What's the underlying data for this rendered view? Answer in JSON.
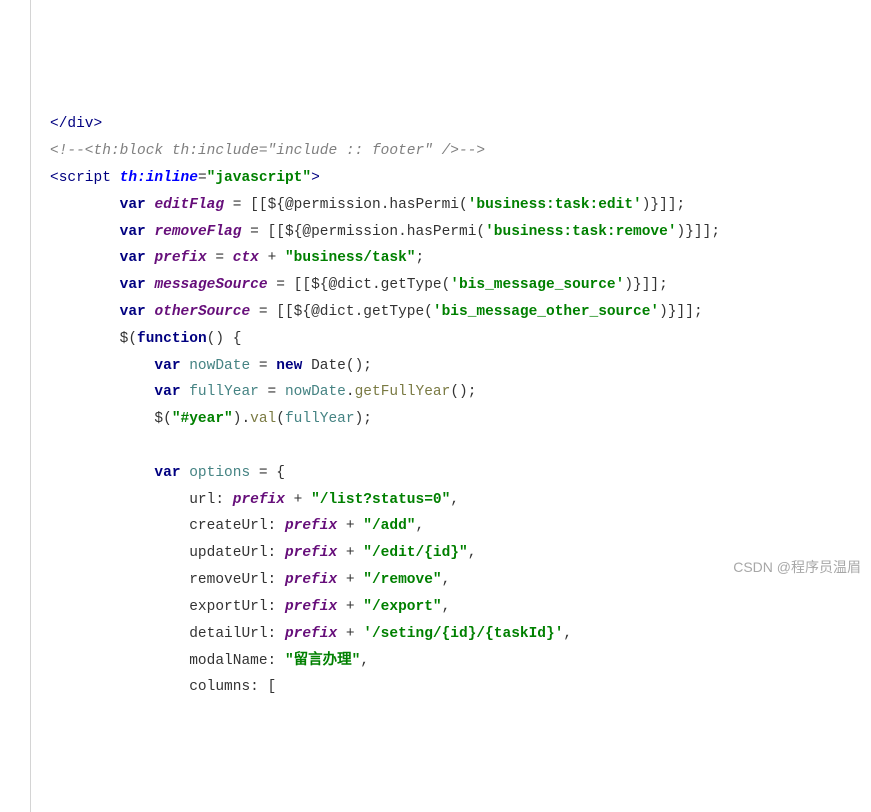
{
  "line1": {
    "closeDiv": "</",
    "div": "div",
    "gt": ">"
  },
  "line2": {
    "open": "<!--<th:block th:include=\"include :: footer\" />-->"
  },
  "line3": {
    "lt": "<",
    "script": "script",
    "sp": " ",
    "attr": "th:inline",
    "eq": "=",
    "q": "\"",
    "val": "javascript",
    "gt": ">"
  },
  "line4": {
    "indent": "        ",
    "kw": "var",
    "sp": " ",
    "ivar": "editFlag",
    "eq": " = [[${@permission.hasPermi(",
    "s": "'business:task:edit'",
    "tail": ")}]];"
  },
  "line5": {
    "indent": "        ",
    "kw": "var",
    "sp": " ",
    "ivar": "removeFlag",
    "eq": " = [[${@permission.hasPermi(",
    "s": "'business:task:remove'",
    "tail": ")}]];"
  },
  "line6": {
    "indent": "        ",
    "kw": "var",
    "sp": " ",
    "ivar": "prefix",
    "eq": " = ",
    "ctx": "ctx",
    "plus": " + ",
    "s": "\"business/task\"",
    "semi": ";"
  },
  "line7": {
    "indent": "        ",
    "kw": "var",
    "sp": " ",
    "ivar": "messageSource",
    "eq": " = [[${@dict.getType(",
    "s": "'bis_message_source'",
    "tail": ")}]];"
  },
  "line8": {
    "indent": "        ",
    "kw": "var",
    "sp": " ",
    "ivar": "otherSource",
    "eq": " = [[${@dict.getType(",
    "s": "'bis_message_other_source'",
    "tail": ")}]];"
  },
  "line9": {
    "indent": "        ",
    "txt1": "$(",
    "kw": "function",
    "txt2": "() {"
  },
  "line10": {
    "indent": "            ",
    "kw1": "var",
    "sp": " ",
    "lvar": "nowDate",
    "eq": " = ",
    "kw2": "new",
    "sp2": " ",
    "date": "Date",
    "tail": "();"
  },
  "line11": {
    "indent": "            ",
    "kw1": "var",
    "sp": " ",
    "lvar": "fullYear",
    "eq": " = ",
    "nowDate": "nowDate",
    "dot": ".",
    "fn": "getFullYear",
    "tail": "();"
  },
  "line12": {
    "indent": "            ",
    "a": "$(",
    "s": "\"#year\"",
    "b": ").",
    "fn": "val",
    "c": "(",
    "lvar": "fullYear",
    "d": ");"
  },
  "blank13": " ",
  "line14": {
    "indent": "            ",
    "kw": "var",
    "sp": " ",
    "lvar": "options",
    "tail": " = {"
  },
  "line15": {
    "indent": "                ",
    "key": "url: ",
    "ivar": "prefix",
    "plus": " + ",
    "s": "\"/list?status=0\"",
    "c": ","
  },
  "line16": {
    "indent": "                ",
    "key": "createUrl: ",
    "ivar": "prefix",
    "plus": " + ",
    "s": "\"/add\"",
    "c": ","
  },
  "line17": {
    "indent": "                ",
    "key": "updateUrl: ",
    "ivar": "prefix",
    "plus": " + ",
    "s": "\"/edit/{id}\"",
    "c": ","
  },
  "line18": {
    "indent": "                ",
    "key": "removeUrl: ",
    "ivar": "prefix",
    "plus": " + ",
    "s": "\"/remove\"",
    "c": ","
  },
  "line19": {
    "indent": "                ",
    "key": "exportUrl: ",
    "ivar": "prefix",
    "plus": " + ",
    "s": "\"/export\"",
    "c": ","
  },
  "line20": {
    "indent": "                ",
    "key": "detailUrl: ",
    "ivar": "prefix",
    "plus": " + ",
    "s": "'/seting/{id}/{taskId}'",
    "c": ","
  },
  "line21": {
    "indent": "                ",
    "key": "modalName: ",
    "s": "\"留言办理\"",
    "c": ","
  },
  "line22": {
    "indent": "                ",
    "key": "columns: ["
  },
  "watermark": "CSDN @程序员温眉"
}
